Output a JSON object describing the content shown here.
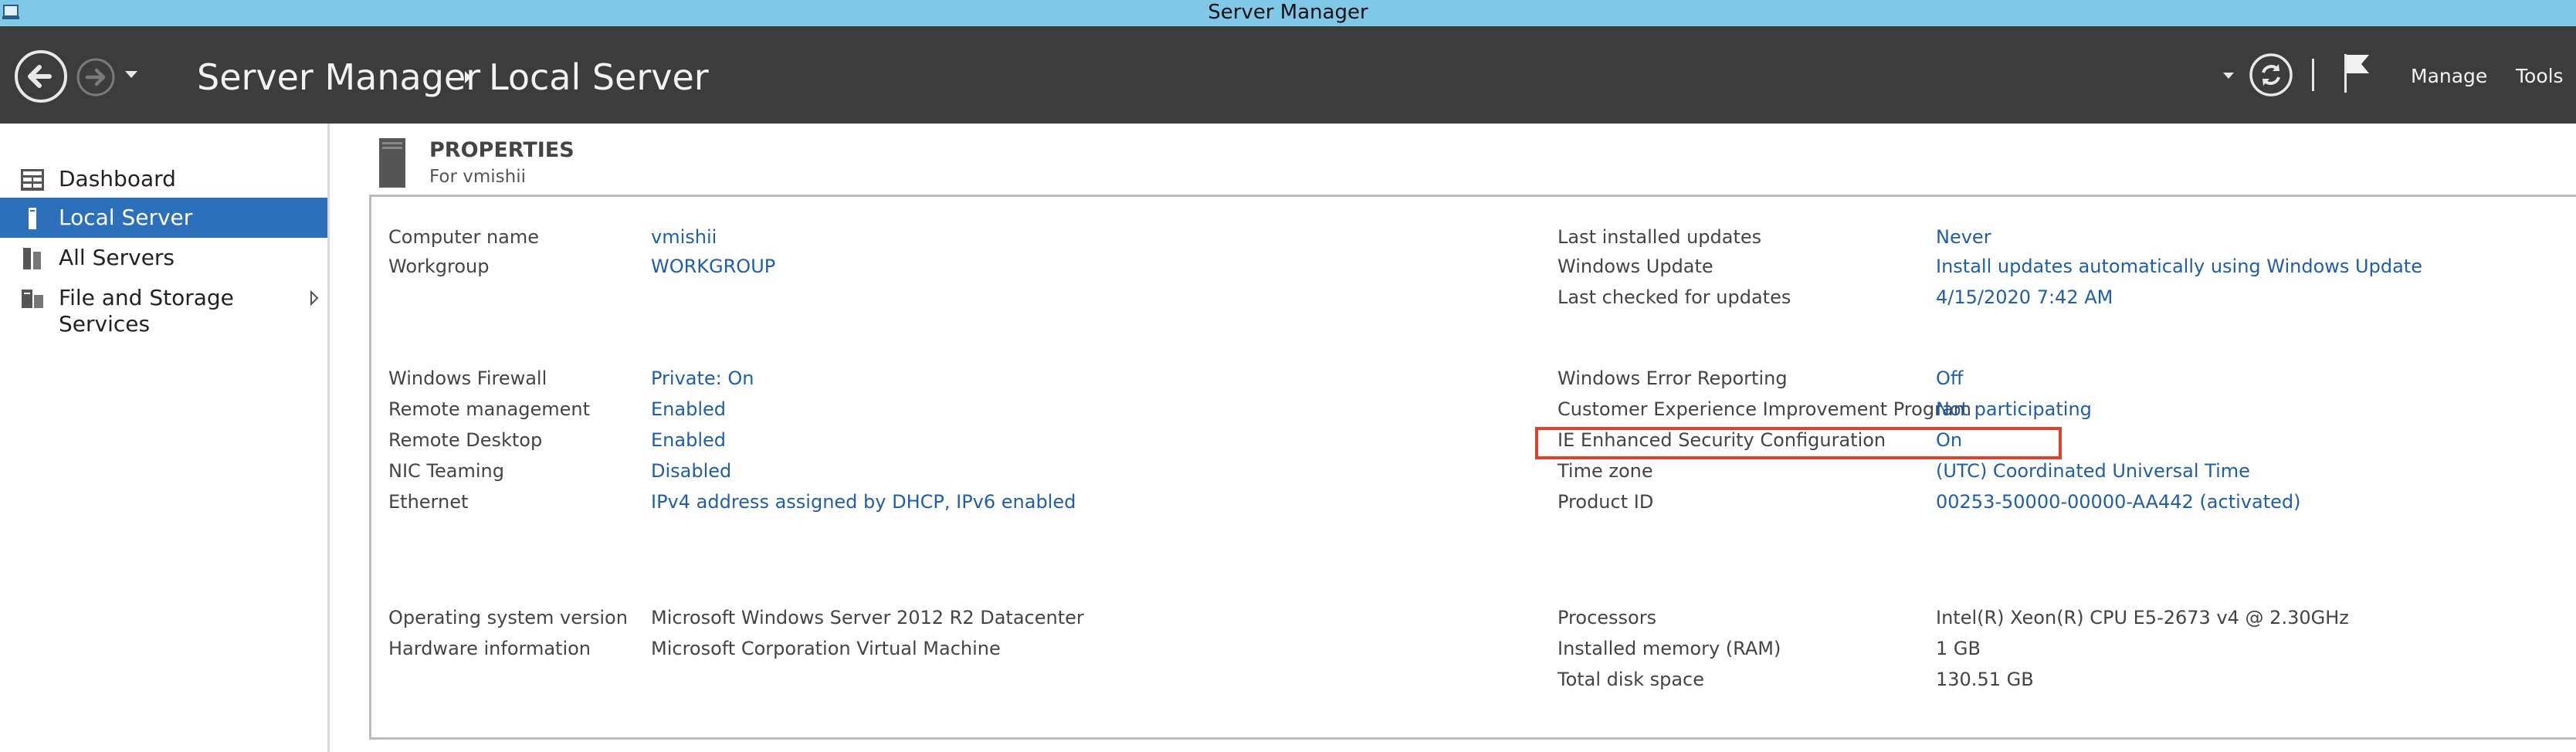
{
  "window": {
    "title": "Server Manager",
    "app_icon": "server-manager-app-icon"
  },
  "header": {
    "breadcrumb": [
      "Server Manager",
      "Local Server"
    ],
    "menu": [
      "Manage",
      "Tools"
    ]
  },
  "sidebar": {
    "items": [
      {
        "label": "Dashboard",
        "icon": "dashboard-icon",
        "selected": false
      },
      {
        "label": "Local Server",
        "icon": "local-server-icon",
        "selected": true
      },
      {
        "label": "All Servers",
        "icon": "all-servers-icon",
        "selected": false
      },
      {
        "label": "File and Storage Services",
        "icon": "storage-icon",
        "selected": false,
        "expandable": true
      }
    ]
  },
  "properties": {
    "title": "PROPERTIES",
    "subtitle": "For vmishii",
    "left": [
      {
        "label": "Computer name",
        "value": "vmishii",
        "link": true
      },
      {
        "label": "Workgroup",
        "value": "WORKGROUP",
        "link": true
      },
      {
        "label": "Windows Firewall",
        "value": "Private: On",
        "link": true
      },
      {
        "label": "Remote management",
        "value": "Enabled",
        "link": true
      },
      {
        "label": "Remote Desktop",
        "value": "Enabled",
        "link": true
      },
      {
        "label": "NIC Teaming",
        "value": "Disabled",
        "link": true
      },
      {
        "label": "Ethernet",
        "value": "IPv4 address assigned by DHCP, IPv6 enabled",
        "link": true
      },
      {
        "label": "Operating system version",
        "value": "Microsoft Windows Server 2012 R2 Datacenter",
        "link": false
      },
      {
        "label": "Hardware information",
        "value": "Microsoft Corporation Virtual Machine",
        "link": false
      }
    ],
    "right": [
      {
        "label": "Last installed updates",
        "value": "Never",
        "link": true
      },
      {
        "label": "Windows Update",
        "value": "Install updates automatically using Windows Update",
        "link": true
      },
      {
        "label": "Last checked for updates",
        "value": "4/15/2020 7:42 AM",
        "link": true
      },
      {
        "label": "Windows Error Reporting",
        "value": "Off",
        "link": true
      },
      {
        "label": "Customer Experience Improvement Program",
        "value": "Not participating",
        "link": true
      },
      {
        "label": "IE Enhanced Security Configuration",
        "value": "On",
        "link": true,
        "highlighted": true
      },
      {
        "label": "Time zone",
        "value": "(UTC) Coordinated Universal Time",
        "link": true
      },
      {
        "label": "Product ID",
        "value": "00253-50000-00000-AA442 (activated)",
        "link": true
      },
      {
        "label": "Processors",
        "value": "Intel(R) Xeon(R) CPU E5-2673 v4 @ 2.30GHz",
        "link": false
      },
      {
        "label": "Installed memory (RAM)",
        "value": "1 GB",
        "link": false
      },
      {
        "label": "Total disk space",
        "value": "130.51 GB",
        "link": false
      }
    ]
  },
  "colors": {
    "title_bar": "#7fc8e8",
    "header_bg": "#3c3c3c",
    "selected_nav": "#2c6fba",
    "link": "#1e5db0",
    "highlight": "#e2402a"
  }
}
